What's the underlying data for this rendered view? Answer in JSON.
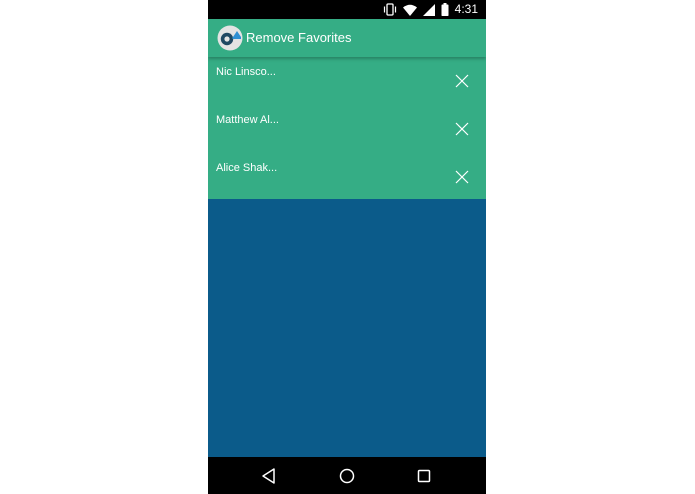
{
  "status_bar": {
    "time": "4:31",
    "icons": [
      "vibrate-icon",
      "wifi-icon",
      "signal-icon",
      "battery-icon"
    ]
  },
  "app_bar": {
    "logo": "app-logo-icon",
    "title": "Remove Favorites"
  },
  "favorites": [
    {
      "name": "Nic Linsco...",
      "action_icon": "close-icon"
    },
    {
      "name": "Matthew Al...",
      "action_icon": "close-icon"
    },
    {
      "name": "Alice Shak...",
      "action_icon": "close-icon"
    }
  ],
  "nav_bar": {
    "items": [
      "back-icon",
      "home-icon",
      "recents-icon"
    ]
  },
  "colors": {
    "app_bar": "#35ad85",
    "list_background": "#35ad85",
    "content_background": "#0b5b8a",
    "system_bars": "#000000"
  }
}
